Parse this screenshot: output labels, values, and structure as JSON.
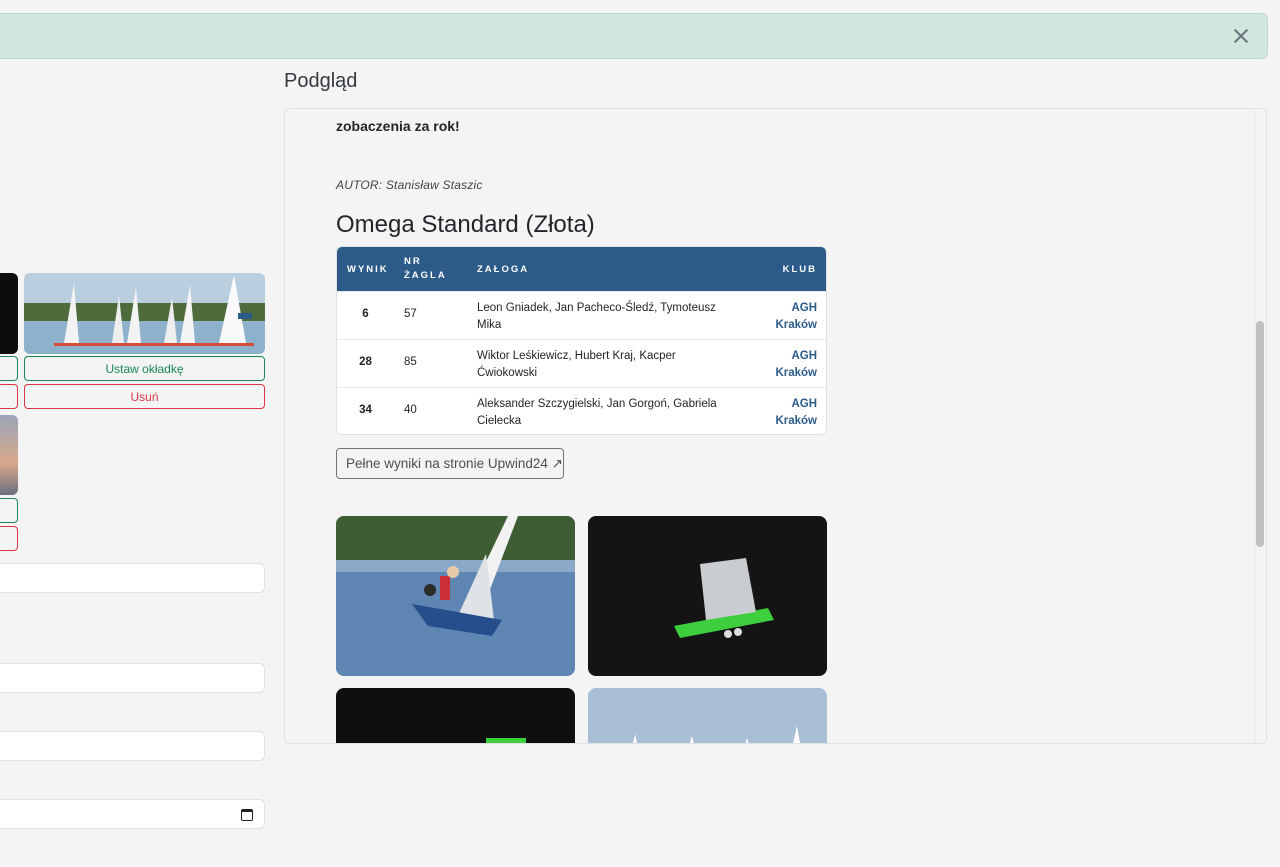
{
  "alert": {
    "close_label": ""
  },
  "left_form": {
    "set_cover_label": "Ustaw okładkę",
    "delete_label": "Usuń"
  },
  "preview": {
    "title": "Podgląd",
    "lead_text": "zobaczenia za rok!",
    "author": "AUTOR: Stanisław Staszic",
    "class_heading": "Omega Standard (Złota)",
    "table": {
      "headers": {
        "result": "WYNIK",
        "sail_line1": "NR",
        "sail_line2": "ŻAGLA",
        "crew": "ZAŁOGA",
        "club": "KLUB"
      },
      "rows": [
        {
          "result": "6",
          "sail": "57",
          "crew_line1": "Leon Gniadek, Jan Pacheco-Śledź, Tymoteusz",
          "crew_line2": "Mika",
          "club_line1": "AGH",
          "club_line2": "Kraków"
        },
        {
          "result": "28",
          "sail": "85",
          "crew_line1": "Wiktor Leśkiewicz, Hubert Kraj, Kacper",
          "crew_line2": "Ćwiokowski",
          "club_line1": "AGH",
          "club_line2": "Kraków"
        },
        {
          "result": "34",
          "sail": "40",
          "crew_line1": "Aleksander Szczygielski, Jan Gorgoń, Gabriela",
          "crew_line2": "Cielecka",
          "club_line1": "AGH",
          "club_line2": "Kraków"
        }
      ]
    },
    "full_results_link": "Pełne wyniki na stronie Upwind24 ↗"
  },
  "colors": {
    "accent": "#2c5b8a",
    "success": "#198754",
    "danger": "#dc3545",
    "alert_bg": "#d1e7dd"
  }
}
